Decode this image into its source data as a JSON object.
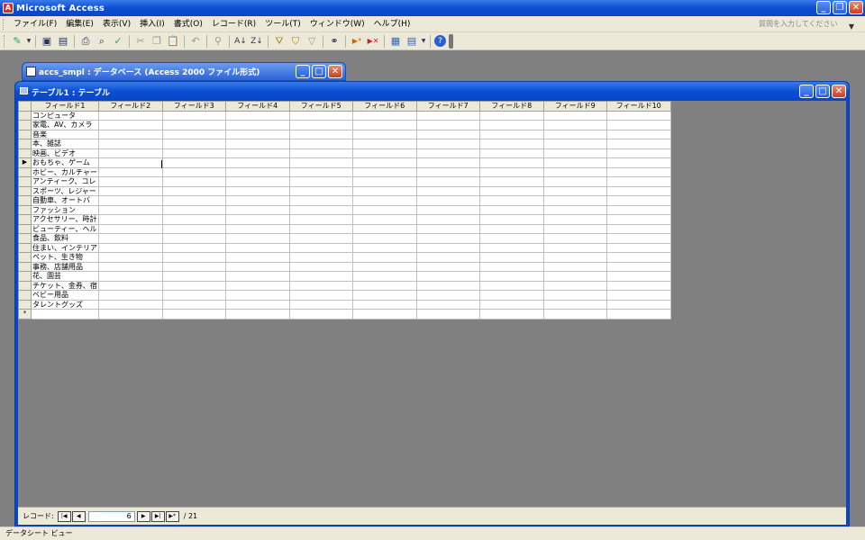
{
  "app": {
    "title": "Microsoft Access"
  },
  "menubar": {
    "items": [
      "ファイル(F)",
      "編集(E)",
      "表示(V)",
      "挿入(I)",
      "書式(O)",
      "レコード(R)",
      "ツール(T)",
      "ウィンドウ(W)",
      "ヘルプ(H)"
    ],
    "help_placeholder": "質問を入力してください"
  },
  "toolbar": {
    "icons": [
      "design-view-icon",
      "save-icon",
      "print-preview-icon",
      "print-icon",
      "preview-icon",
      "spelling-icon",
      "cut-icon",
      "copy-icon",
      "paste-icon",
      "undo-icon",
      "hyperlink-icon",
      "sort-asc-icon",
      "sort-desc-icon",
      "filter-selection-icon",
      "filter-form-icon",
      "apply-filter-icon",
      "find-icon",
      "new-record-icon",
      "delete-record-icon",
      "database-window-icon",
      "new-object-icon",
      "help-icon"
    ]
  },
  "db_window": {
    "title": "accs_smpl : データベース (Access 2000 ファイル形式)"
  },
  "table_window": {
    "title": "テーブル1 : テーブル",
    "columns": [
      "フィールド1",
      "フィールド2",
      "フィールド3",
      "フィールド4",
      "フィールド5",
      "フィールド6",
      "フィールド7",
      "フィールド8",
      "フィールド9",
      "フィールド10"
    ],
    "rows": [
      "コンピュータ",
      "家電、AV、カメラ",
      "音楽",
      "本、雑誌",
      "映画、ビデオ",
      "おもちゃ、ゲーム",
      "ホビー、カルチャー",
      "アンティーク、コレ",
      "スポーツ、レジャー",
      "自動車、オートバ",
      "ファッション",
      "アクセサリー、時計",
      "ビューティー、ヘル",
      "食品、飲料",
      "住まい、インテリア",
      "ペット、生き物",
      "事務、店舗用品",
      "花、園芸",
      "チケット、金券、宿",
      "ベビー用品",
      "タレントグッズ"
    ],
    "current_row": 6,
    "new_row_marker": "*",
    "current_marker": "▶"
  },
  "navigation": {
    "label": "レコード:",
    "current": "6",
    "total": "/ 21",
    "buttons": [
      "|◀",
      "◀",
      "▶",
      "▶|",
      "▶*"
    ]
  },
  "statusbar": {
    "text": "データシート ビュー"
  }
}
